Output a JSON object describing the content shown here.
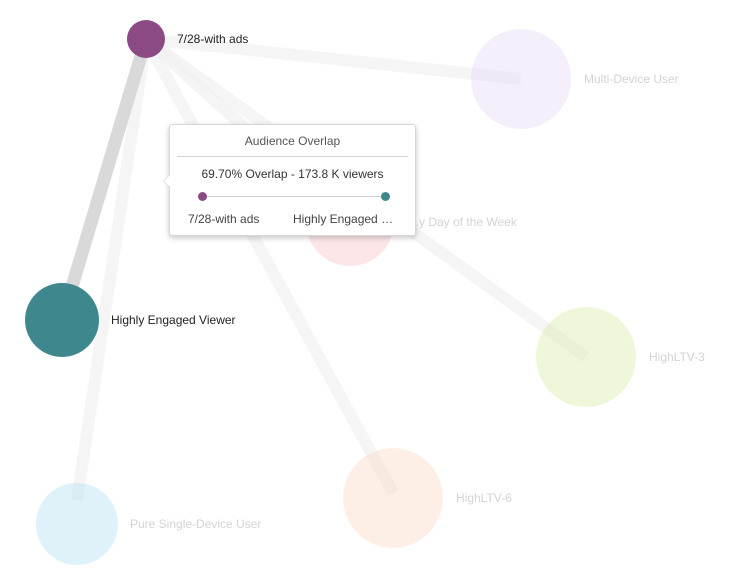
{
  "diagram": {
    "colors": {
      "link_strong": "#d9d9d9",
      "link_faint": "#f2f2f2",
      "label_active": "#222222",
      "label_faded": "#d3d3d3"
    },
    "nodes": [
      {
        "id": "n728",
        "label": "7/28-with ads",
        "color": "#8c4a85",
        "opacity": 1.0,
        "active": true
      },
      {
        "id": "nhev",
        "label": "Highly Engaged Viewer",
        "color": "#3e888d",
        "opacity": 1.0,
        "active": true
      },
      {
        "id": "nmdu",
        "label": "Multi-Device User",
        "color": "#e6dbf7",
        "opacity": 0.45,
        "active": false
      },
      {
        "id": "ndow",
        "label": "...y Day of the Week",
        "color": "#f8c7cc",
        "opacity": 0.45,
        "active": false
      },
      {
        "id": "nh3",
        "label": "HighLTV-3",
        "color": "#dbeeb0",
        "opacity": 0.45,
        "active": false
      },
      {
        "id": "nh6",
        "label": "HighLTV-6",
        "color": "#fbdcc8",
        "opacity": 0.45,
        "active": false
      },
      {
        "id": "npsd",
        "label": "Pure Single-Device User",
        "color": "#b9e2f1",
        "opacity": 0.45,
        "active": false
      }
    ],
    "links": [
      {
        "source": "n728",
        "target": "nhev",
        "strong": true
      },
      {
        "source": "n728",
        "target": "nmdu",
        "strong": false
      },
      {
        "source": "n728",
        "target": "ndow",
        "strong": false
      },
      {
        "source": "n728",
        "target": "nh3",
        "strong": false
      },
      {
        "source": "n728",
        "target": "nh6",
        "strong": false
      },
      {
        "source": "n728",
        "target": "npsd",
        "strong": false
      }
    ]
  },
  "tooltip": {
    "title": "Audience Overlap",
    "overlap_text": "69.70% Overlap - 173.8 K viewers",
    "source_name": "7/28-with ads",
    "target_name": "Highly Engaged Viewer",
    "source_color": "#8c4a85",
    "target_color": "#3e888d"
  }
}
